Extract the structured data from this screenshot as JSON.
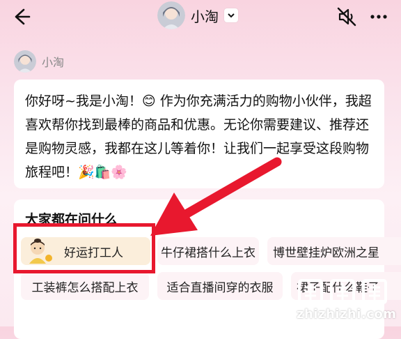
{
  "header": {
    "title": "小淘",
    "back_icon": "arrow-left-icon",
    "dropdown_icon": "chevron-down-icon",
    "mute_icon": "speaker-muted-icon",
    "more_icon": "more-dots-icon"
  },
  "message": {
    "sender": "小淘",
    "text": "你好呀~我是小淘！😊 作为你充满活力的购物小伙伴，我超喜欢帮你找到最棒的商品和优惠。无论你需要建议、推荐还是购物灵感，我都在这儿等着你！让我们一起享受这段购物旅程吧！🎉🛍️🌸"
  },
  "suggestions": {
    "title": "大家都在问什么",
    "items": [
      {
        "label": "好运打工人",
        "icon": "lucky-worker-icon"
      },
      {
        "label": "牛仔裙搭什么上衣"
      },
      {
        "label": "博世壁挂炉欧洲之星"
      },
      {
        "label": "工装裤怎么搭配上衣"
      },
      {
        "label": "适合直播间穿的衣服"
      },
      {
        "label": "裙子配什么鞋子"
      }
    ]
  },
  "annotation": {
    "highlight_color": "#e8182e"
  },
  "watermark": {
    "text": "zhizhizhi.com"
  },
  "colors": {
    "background_top": "#f9d4e0",
    "card": "#ffffff",
    "chip": "#fdf3f6",
    "chip_featured": "#fbeedb"
  }
}
